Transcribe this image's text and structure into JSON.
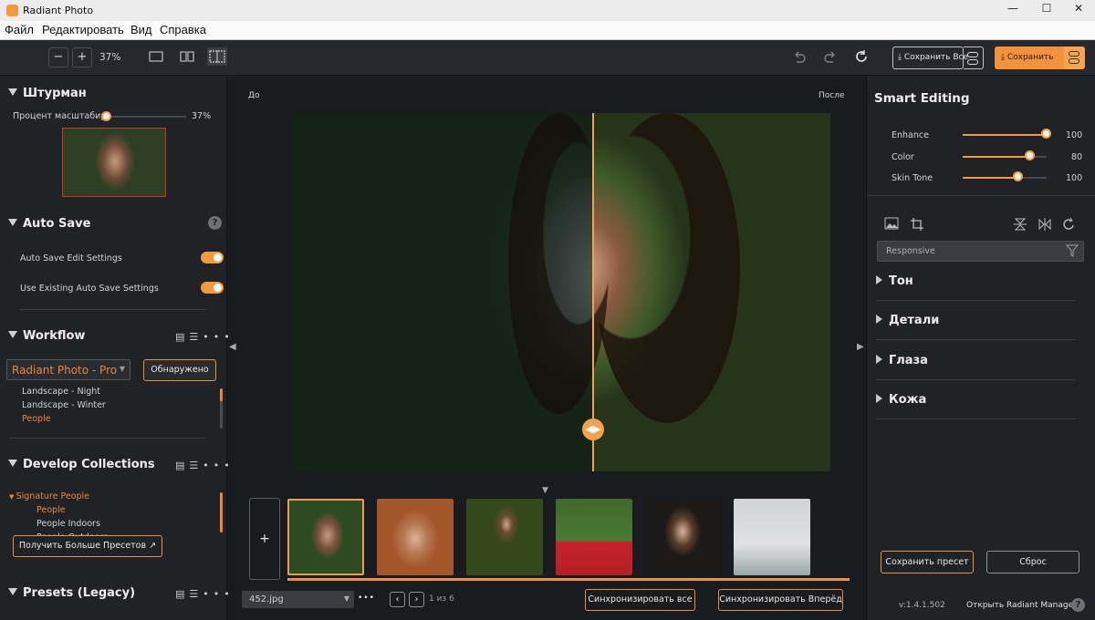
{
  "window": {
    "title": "Radiant Photo",
    "min": "—",
    "max": "☐",
    "close": "✕"
  },
  "menu": [
    "Файл",
    "Редактировать",
    "Вид",
    "Справка"
  ],
  "toolbar": {
    "zoom_out": "−",
    "zoom_in": "+",
    "zoom_level": "37%",
    "save_all_label": "Сохранить Все",
    "save_label": "Сохранить"
  },
  "navigator": {
    "title": "Штурман",
    "zoom_label": "Процент масштабир",
    "zoom_value": "37%",
    "zoom_fraction": 0.03
  },
  "autosave": {
    "title": "Auto Save",
    "help": "?",
    "items": [
      {
        "label": "Auto Save Edit Settings",
        "on": true
      },
      {
        "label": "Use Existing Auto Save Settings",
        "on": true
      }
    ]
  },
  "workflow": {
    "title": "Workflow",
    "dropdown_value": "Radiant Photo - Pro",
    "detected_button": "Обнаружено",
    "items": [
      "Landscape - Night",
      "Landscape - Winter",
      "People"
    ],
    "selected": "People"
  },
  "collections": {
    "title": "Develop Collections",
    "group": "Signature People",
    "items": [
      "People",
      "People Indoors",
      "People Outdoors"
    ],
    "more_button": "Получить Больше Пресетов"
  },
  "presets": {
    "title": "Presets (Legacy)"
  },
  "canvas": {
    "before_label": "До",
    "after_label": "После"
  },
  "filmstrip": {
    "add": "+",
    "file_name": "452.jpg",
    "page_info": "1 из 6",
    "sync_all": "Синхронизировать все",
    "sync_forward": "Синхронизировать Вперёд",
    "more": "•••"
  },
  "smart_editing": {
    "title": "Smart Editing",
    "sliders": [
      {
        "label": "Enhance",
        "value": "100",
        "fraction": 1.0
      },
      {
        "label": "Color",
        "value": "80",
        "fraction": 0.8
      },
      {
        "label": "Skin Tone",
        "value": "100",
        "fraction": 0.66
      }
    ]
  },
  "adjust": {
    "preset_value": "Responsive",
    "sections": [
      "Тон",
      "Детали",
      "Глаза",
      "Кожа"
    ]
  },
  "footer": {
    "save_preset": "Сохранить пресет",
    "reset": "Сброс",
    "version": "v:1.4.1.502",
    "open_manager": "Открыть Radiant Manager",
    "help": "?"
  },
  "colors": {
    "accent": "#f29a3c",
    "panel": "#202226",
    "canvas": "#1a1b1f"
  }
}
